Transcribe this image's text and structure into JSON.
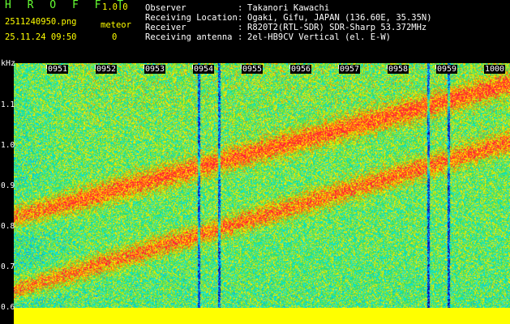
{
  "header": {
    "logo": "H R O F F T",
    "version": "1.0.0",
    "file_name": "2511240950.png",
    "meteor_label": "meteor",
    "datetime": "25.11.24 09:50",
    "meteor_count": "0",
    "rows": [
      {
        "label": "Observer",
        "value": "Takanori Kawachi"
      },
      {
        "label": "Receiving Location",
        "value": "Ogaki, Gifu, JAPAN (136.60E, 35.35N)"
      },
      {
        "label": "Receiver",
        "value": "R820T2(RTL-SDR) SDR-Sharp 53.372MHz"
      },
      {
        "label": "Receiving antenna",
        "value": "2el-HB9CV Vertical (el. E-W)"
      }
    ]
  },
  "axis": {
    "y_unit": "kHz",
    "y_ticks": [
      "1.1",
      "1.0",
      "0.9",
      "0.8",
      "0.7",
      "0.6"
    ],
    "x_ticks": [
      "0951",
      "0952",
      "0953",
      "0954",
      "0955",
      "0956",
      "0957",
      "0958",
      "0959",
      "1000"
    ]
  },
  "colors": {
    "header_text": "#ffffff",
    "logo": "#66ff33",
    "version": "#ffff00",
    "bottom_band": "#ffff00"
  }
}
